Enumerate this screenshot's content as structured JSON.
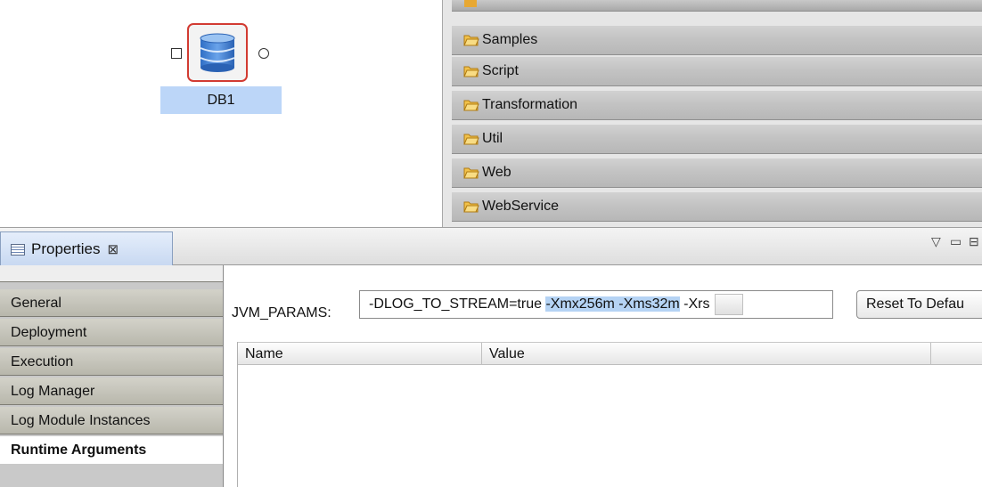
{
  "canvas": {
    "node": {
      "label": "DB1",
      "icon": "database-icon"
    }
  },
  "palette": {
    "folders": [
      {
        "label": "Samples",
        "icon": "folder-icon"
      },
      {
        "label": "Script",
        "icon": "folder-icon"
      },
      {
        "label": "Transformation",
        "icon": "folder-icon"
      },
      {
        "label": "Util",
        "icon": "folder-icon"
      },
      {
        "label": "Web",
        "icon": "folder-icon"
      },
      {
        "label": "WebService",
        "icon": "folder-icon"
      }
    ]
  },
  "properties": {
    "tab_label": "Properties",
    "close_glyph": "⊠",
    "view_menu_glyph": "▽",
    "minimize_glyph": "▭",
    "maximize_glyph": "⊟",
    "nav": [
      {
        "label": "General"
      },
      {
        "label": "Deployment"
      },
      {
        "label": "Execution"
      },
      {
        "label": "Log Manager"
      },
      {
        "label": "Log Module Instances"
      },
      {
        "label": "Runtime Arguments",
        "selected": true
      }
    ],
    "jvm": {
      "label": "JVM_PARAMS:",
      "value_prefix": "-DLOG_TO_STREAM=true ",
      "value_selected": "-Xmx256m -Xms32m",
      "value_suffix": " -Xrs"
    },
    "reset_button": "Reset To Defau",
    "table": {
      "columns": [
        "Name",
        "Value"
      ]
    }
  },
  "colors": {
    "selection": "#b5d3f4",
    "node_border": "#d23b32",
    "node_label_bg": "#bcd6f8",
    "folder": "#e8a832"
  }
}
